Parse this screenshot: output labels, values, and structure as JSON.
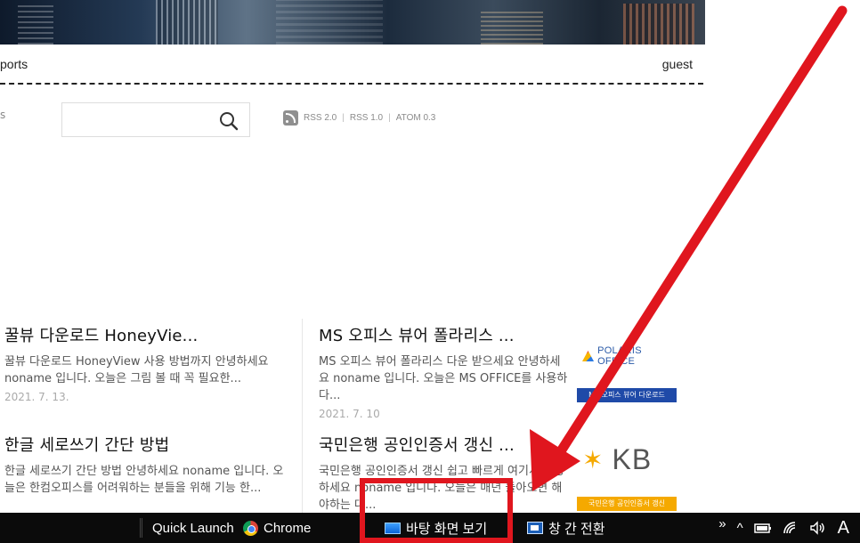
{
  "header": {
    "nav_left": "ports",
    "nav_right": "guest"
  },
  "sidebar_stub": "s",
  "search": {
    "placeholder": ""
  },
  "feeds": {
    "rss2": "RSS 2.0",
    "rss1": "RSS 1.0",
    "atom": "ATOM 0.3",
    "sep": "|"
  },
  "posts": [
    {
      "title": "꿀뷰 다운로드 HoneyVie...",
      "excerpt": "꿀뷰 다운로드 HoneyView 사용 방법까지 안녕하세요 noname 입니다. 오늘은 그림 볼 때 꼭 필요한...",
      "date": "2021. 7. 13."
    },
    {
      "title": "MS 오피스 뷰어 폴라리스 ...",
      "excerpt": "MS 오피스 뷰어 폴라리스 다운 받으세요 안녕하세요 noname 입니다. 오늘은 MS OFFICE를 사용하다...",
      "date": "2021. 7. 10"
    },
    {
      "title": "한글 세로쓰기 간단 방법",
      "excerpt": "한글 세로쓰기 간단 방법 안녕하세요 noname 입니다. 오늘은 한컴오피스를 어려워하는 분들을 위해 기능 한...",
      "date": ""
    },
    {
      "title": "국민은행 공인인증서 갱신 ...",
      "excerpt": "국민은행 공인인증서 갱신 쉽고 빠르게 여기서 인증하세요 noname 입니다. 오늘은 매년 돌아오면 해야하는 대...",
      "date": ""
    }
  ],
  "thumbs": {
    "polaris_logo": "POLARIS OFFICE",
    "polaris_bar": "MS 오피스 뷰어 다운로드",
    "kb_word": "KB",
    "kb_bar": "국민은행 공인인증서 갱신"
  },
  "taskbar": {
    "quick_launch": "Quick Launch",
    "chrome": "Chrome",
    "show_desktop": "바탕 화면 보기",
    "switch_windows": "창 간 전환",
    "tray_more": "»",
    "tray_up": "^",
    "ime": "A"
  },
  "colors": {
    "highlight": "#e0161e",
    "taskbar": "#0b0b0b",
    "kb_yellow": "#f5a900",
    "polaris_blue": "#1f4aa8"
  }
}
